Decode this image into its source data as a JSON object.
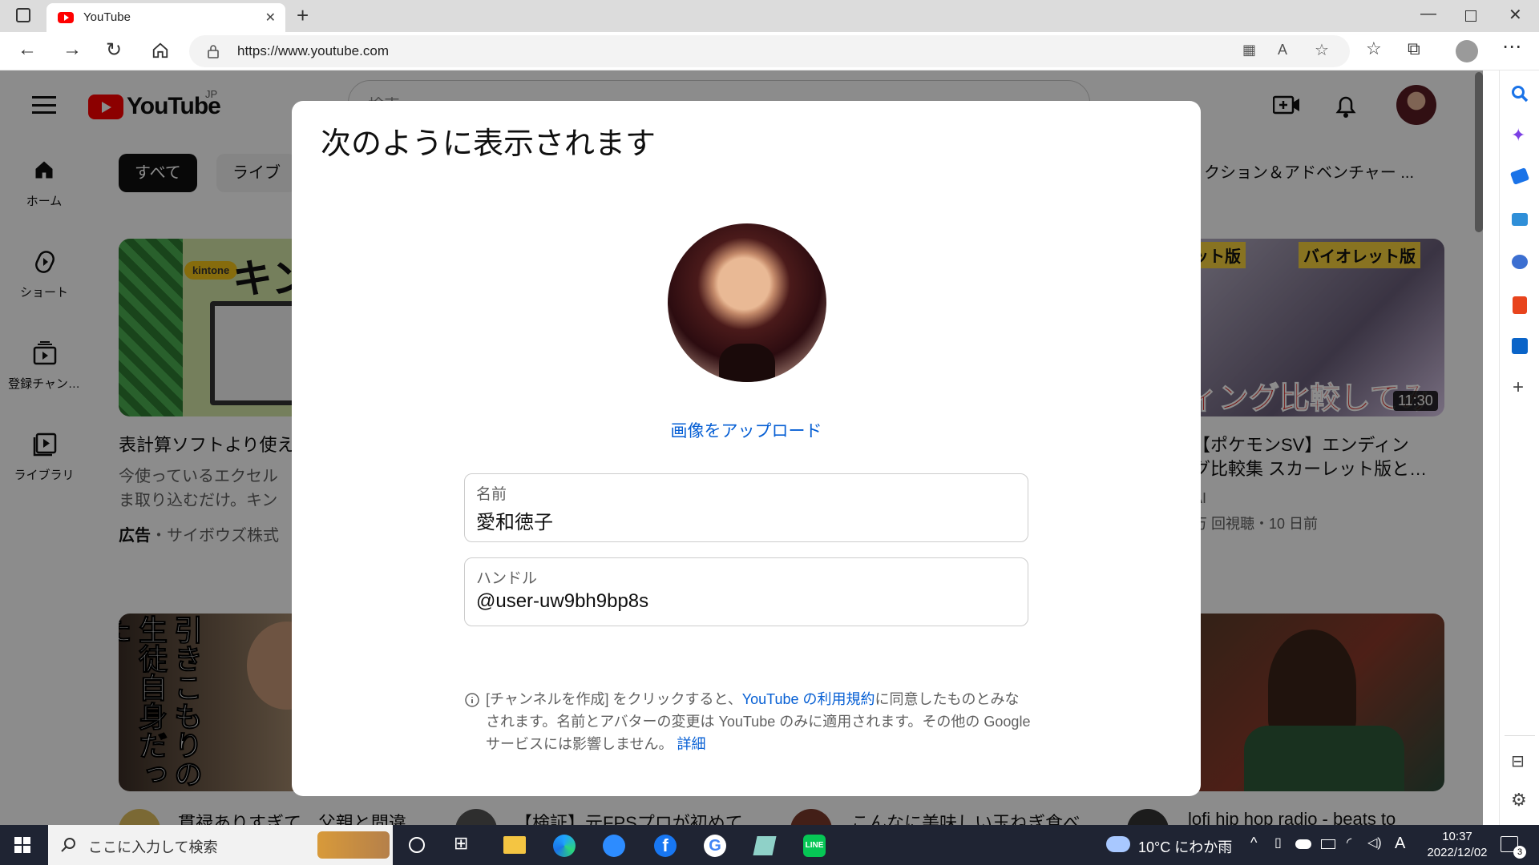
{
  "browser": {
    "tab_title": "YouTube",
    "url": "https://www.youtube.com"
  },
  "youtube": {
    "logo_text": "YouTube",
    "region": "JP",
    "search_placeholder": "検索",
    "nav": [
      {
        "label": "ホーム",
        "icon": "home-icon"
      },
      {
        "label": "ショート",
        "icon": "shorts-icon"
      },
      {
        "label": "登録チャン…",
        "icon": "subscriptions-icon"
      },
      {
        "label": "ライブラリ",
        "icon": "library-icon"
      }
    ],
    "chips": [
      "すべて",
      "ライブ",
      "クション＆アドベンチャー ..."
    ],
    "videos_row1": [
      {
        "thumb_text": "キン",
        "thumb_badge": "kintone",
        "title": "表計算ソフトより使え",
        "desc_line1": "今使っているエクセル",
        "desc_line2": "ま取り込むだけ。キン",
        "ad_label": "広告",
        "channel": "・サイボウズ株式"
      },
      {
        "thumb_tag1": "ット版",
        "thumb_tag2": "バイオレット版",
        "thumb_big": "ィング比較してみ",
        "duration": "11:30",
        "title_line1": "【ポケモンSV】エンディン",
        "title_line2": "グ比較集 スカーレット版と…",
        "channel": "AI",
        "meta": "万 回視聴・10 日前"
      }
    ],
    "videos_row2": [
      {
        "thumb_text": "引きこもりの生徒自身だった",
        "title": "貫禄ありすぎて、父親と間違"
      },
      {
        "title": "【検証】元FPSプロが初めて"
      },
      {
        "title": "こんなに美味しい玉ねぎ食べ"
      },
      {
        "title": "lofi hip hop radio - beats to"
      }
    ]
  },
  "dialog": {
    "title": "次のように表示されます",
    "upload_link": "画像をアップロード",
    "name_label": "名前",
    "name_value": "愛和徳子",
    "handle_label": "ハンドル",
    "handle_value": "@user-uw9bh9bp8s",
    "note_part1": "[チャンネルを作成] をクリックすると、",
    "note_link": "YouTube の利用規約",
    "note_part2": "に同意したものとみなされます。名前とアバターの変更は YouTube のみに適用されます。その他の Google サービスには影響しません。",
    "note_detail": "詳細"
  },
  "taskbar": {
    "search_text": "ここに入力して検索",
    "weather": "10°C にわか雨",
    "ime": "A",
    "time": "10:37",
    "date": "2022/12/02",
    "notifications": "3"
  },
  "colors": {
    "youtube_red": "#ff0000",
    "link_blue": "#065fd4",
    "taskbar_bg": "#1f2433"
  }
}
